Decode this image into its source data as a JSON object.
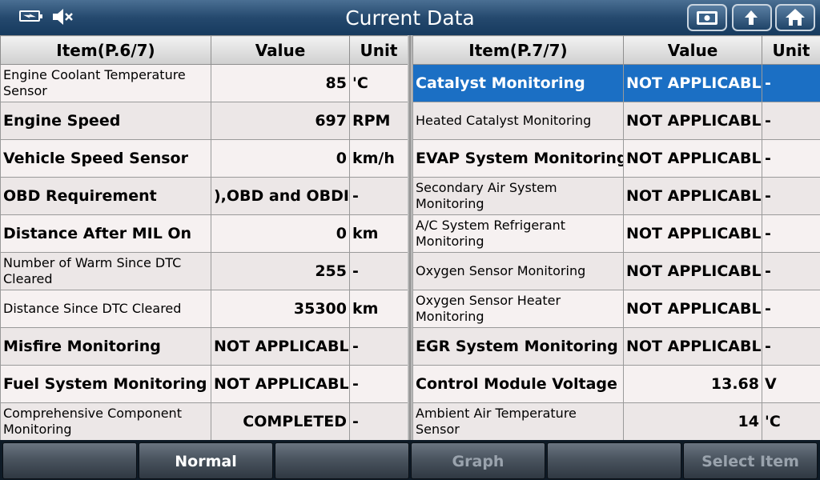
{
  "header": {
    "title": "Current Data",
    "icons": [
      "battery-icon",
      "speaker-muted-icon",
      "screenshot-icon",
      "up-arrow-icon",
      "home-icon"
    ]
  },
  "left_table": {
    "columns": [
      "Item(P.6/7)",
      "Value",
      "Unit"
    ],
    "rows": [
      {
        "item": "Engine Coolant Temperature Sensor",
        "value": "85",
        "unit": "'C"
      },
      {
        "item": "Engine Speed",
        "value": "697",
        "unit": "RPM"
      },
      {
        "item": "Vehicle Speed Sensor",
        "value": "0",
        "unit": "km/h"
      },
      {
        "item": "OBD Requirement",
        "value": "),OBD and OBDII",
        "unit": "-"
      },
      {
        "item": "Distance After MIL On",
        "value": "0",
        "unit": "km"
      },
      {
        "item": "Number of Warm Since DTC Cleared",
        "value": "255",
        "unit": "-"
      },
      {
        "item": "Distance Since DTC Cleared",
        "value": "35300",
        "unit": "km"
      },
      {
        "item": "Misfire Monitoring",
        "value": "NOT APPLICABLE",
        "unit": "-"
      },
      {
        "item": "Fuel System Monitoring",
        "value": "NOT APPLICABLE",
        "unit": "-"
      },
      {
        "item": "Comprehensive Component Monitoring",
        "value": "COMPLETED",
        "unit": "-"
      }
    ]
  },
  "right_table": {
    "columns": [
      "Item(P.7/7)",
      "Value",
      "Unit"
    ],
    "rows": [
      {
        "item": "Catalyst Monitoring",
        "value": "NOT APPLICABLE",
        "unit": "-"
      },
      {
        "item": "Heated Catalyst Monitoring",
        "value": "NOT APPLICABLE",
        "unit": "-"
      },
      {
        "item": "EVAP System Monitoring",
        "value": "NOT APPLICABLE",
        "unit": "-"
      },
      {
        "item": "Secondary Air System Monitoring",
        "value": "NOT APPLICABLE",
        "unit": "-"
      },
      {
        "item": "A/C System Refrigerant Monitoring",
        "value": "NOT APPLICABLE",
        "unit": "-"
      },
      {
        "item": "Oxygen Sensor Monitoring",
        "value": "NOT APPLICABLE",
        "unit": "-"
      },
      {
        "item": "Oxygen Sensor Heater Monitoring",
        "value": "NOT APPLICABLE",
        "unit": "-"
      },
      {
        "item": "EGR System Monitoring",
        "value": "NOT APPLICABLE",
        "unit": "-"
      },
      {
        "item": "Control Module Voltage",
        "value": "13.68",
        "unit": "V"
      },
      {
        "item": "Ambient Air Temperature Sensor",
        "value": "14",
        "unit": "'C"
      }
    ]
  },
  "footer": {
    "buttons": [
      "",
      "Normal",
      "",
      "Graph",
      "",
      "Select Item"
    ]
  },
  "colors": {
    "selected_row": "#1b6fc4",
    "title_bar": "#25496e"
  }
}
